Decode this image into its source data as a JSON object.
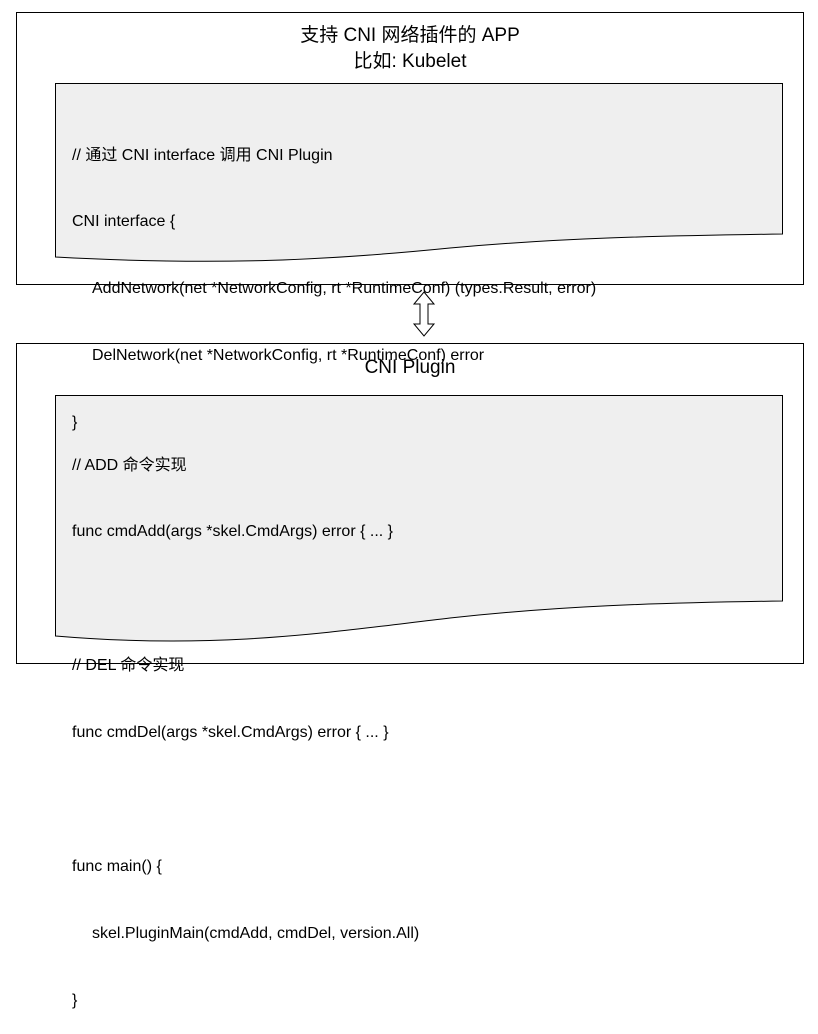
{
  "app_box": {
    "title_line1": "支持 CNI 网络插件的 APP",
    "title_line2": "比如: Kubelet",
    "code_lines": [
      "// 通过 CNI interface 调用 CNI Plugin",
      "CNI interface {",
      "AddNetwork(net *NetworkConfig, rt *RuntimeConf) (types.Result, error)",
      "DelNetwork(net *NetworkConfig, rt *RuntimeConf) error",
      "}"
    ]
  },
  "connector": {
    "icon": "double-headed-vertical-arrow"
  },
  "plugin_box": {
    "title": "CNI Plugin",
    "code_lines": [
      "// ADD 命令实现",
      "func cmdAdd(args *skel.CmdArgs) error { ... }",
      "",
      "// DEL 命令实现",
      "func cmdDel(args *skel.CmdArgs) error { ... }",
      "",
      "func main() {",
      "skel.PluginMain(cmdAdd, cmdDel, version.All)",
      "}"
    ]
  },
  "colors": {
    "doc_fill": "#efefef",
    "stroke": "#000000"
  }
}
